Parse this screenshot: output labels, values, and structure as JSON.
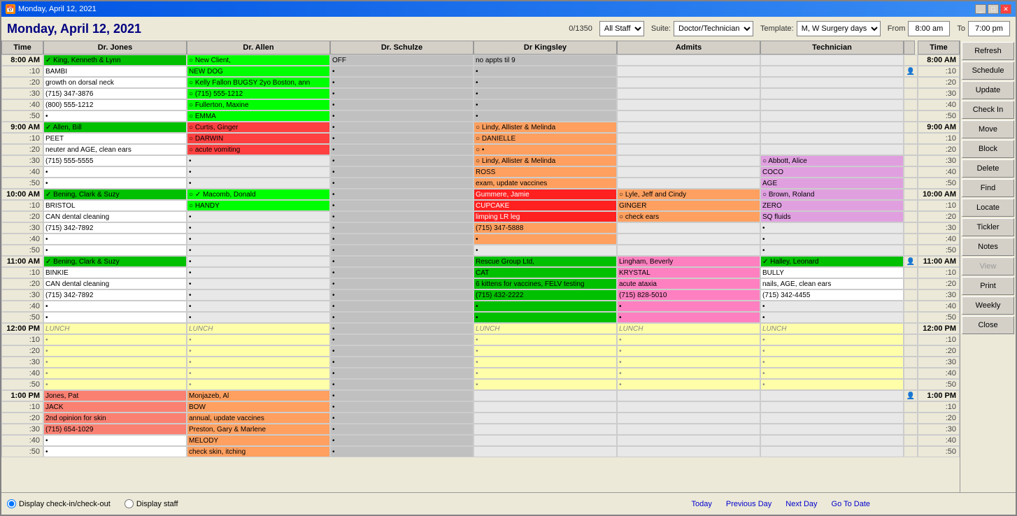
{
  "window": {
    "title": "Monday, April 12, 2021"
  },
  "header": {
    "date_title": "Monday, April 12, 2021",
    "capacity": "0/1350",
    "suite_label": "Suite:",
    "suite_value": "Doctor/Technician",
    "template_label": "Template:",
    "template_value": "M, W Surgery days",
    "from_label": "From",
    "from_value": "8:00 am",
    "to_label": "To",
    "to_value": "7:00 pm",
    "staff_value": "All Staff"
  },
  "columns": {
    "time_label": "Time",
    "jones_label": "Dr. Jones",
    "allen_label": "Dr. Allen",
    "schulze_label": "Dr. Schulze",
    "kingsley_label": "Dr Kingsley",
    "admits_label": "Admits",
    "technician_label": "Technician",
    "time2_label": "Time"
  },
  "sidebar": {
    "refresh": "Refresh",
    "schedule": "Schedule",
    "update": "Update",
    "checkin": "Check In",
    "move": "Move",
    "block": "Block",
    "delete": "Delete",
    "find": "Find",
    "locate": "Locate",
    "tickler": "Tickler",
    "notes": "Notes",
    "view": "View",
    "print": "Print",
    "weekly": "Weekly",
    "close": "Close"
  },
  "bottom": {
    "radio1": "Display check-in/check-out",
    "radio2": "Display staff",
    "today": "Today",
    "prev_day": "Previous Day",
    "next_day": "Next Day",
    "goto": "Go To Date"
  }
}
